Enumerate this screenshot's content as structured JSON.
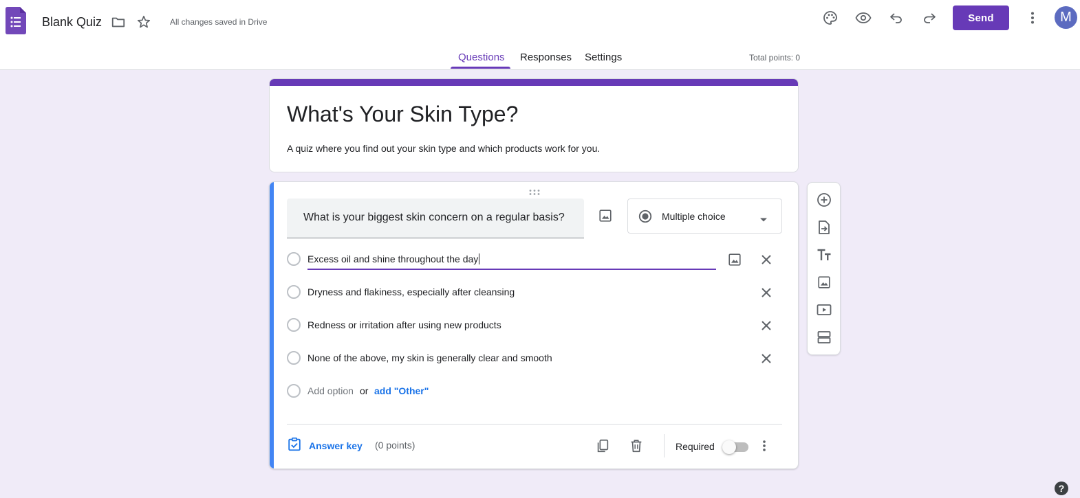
{
  "header": {
    "doc_title": "Blank Quiz",
    "save_status": "All changes saved in Drive",
    "send_label": "Send",
    "avatar_letter": "M"
  },
  "tabs": [
    {
      "label": "Questions",
      "active": true
    },
    {
      "label": "Responses",
      "active": false
    },
    {
      "label": "Settings",
      "active": false
    }
  ],
  "total_points": "Total points: 0",
  "form": {
    "title": "What's Your Skin Type?",
    "description": "A quiz where you find out your skin type and which products work for you."
  },
  "question": {
    "text": "What is your biggest skin concern on a regular basis?",
    "type": "Multiple choice",
    "options": [
      "Excess oil and shine throughout the day",
      "Dryness and flakiness, especially after cleansing",
      "Redness or irritation after using new products",
      "None of the above, my skin is generally clear and smooth"
    ],
    "add_option": "Add option",
    "or_text": "or",
    "add_other": "add \"Other\"",
    "answer_key": "Answer key",
    "points": "(0 points)",
    "required_label": "Required",
    "required": false
  },
  "help_label": "?",
  "colors": {
    "accent": "#673ab7",
    "background": "#f0ebf8",
    "question_strip": "#4285f4",
    "link": "#1a73e8"
  },
  "icons": [
    "forms-logo-icon",
    "folder-icon",
    "star-icon",
    "palette-icon",
    "preview-eye-icon",
    "undo-icon",
    "redo-icon",
    "more-vert-icon",
    "drag-handle-icon",
    "image-icon",
    "radio-button-icon",
    "dropdown-arrow-icon",
    "close-icon",
    "answer-key-icon",
    "duplicate-icon",
    "delete-icon",
    "add-question-icon",
    "import-questions-icon",
    "add-title-icon",
    "add-image-icon",
    "add-video-icon",
    "add-section-icon",
    "help-icon"
  ]
}
